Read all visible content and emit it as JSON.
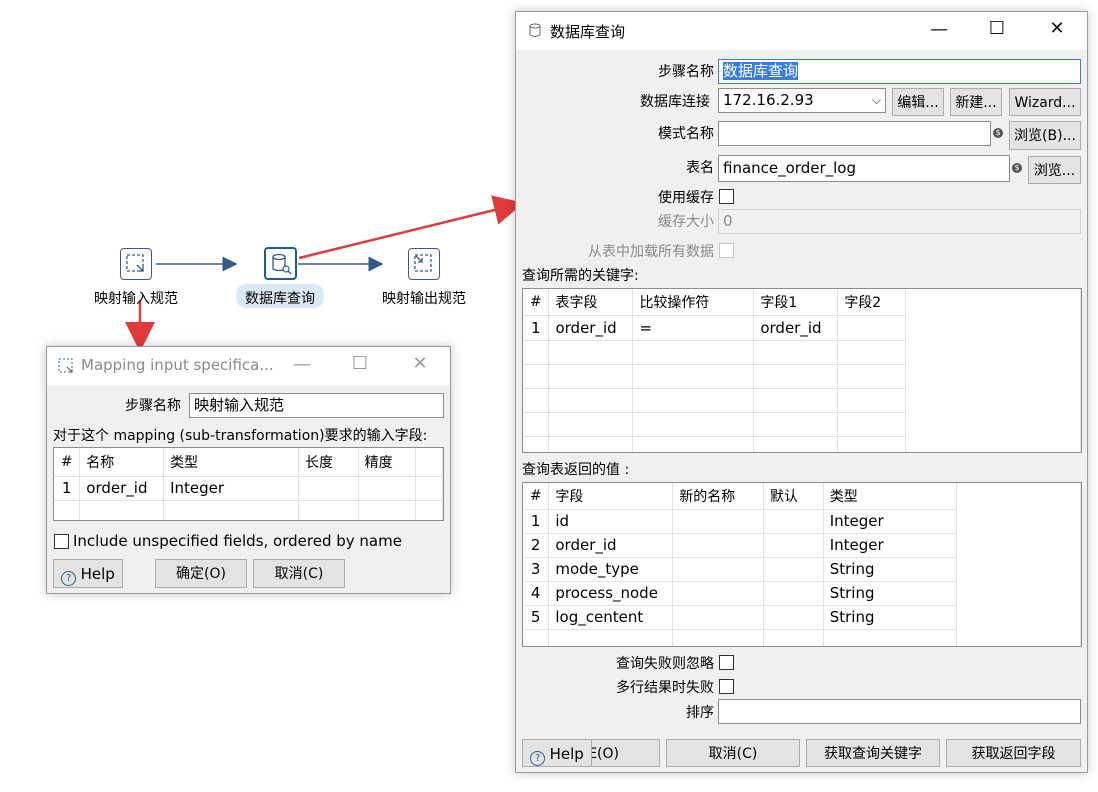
{
  "canvas": {
    "steps": [
      {
        "label": "映射输入规范"
      },
      {
        "label": "数据库查询"
      },
      {
        "label": "映射输出规范"
      }
    ]
  },
  "mapping_dialog": {
    "title": "Mapping input specifica...",
    "step_name_label": "步骤名称",
    "step_name_value": "映射输入规范",
    "fields_caption": "对于这个 mapping (sub-transformation)要求的输入字段:",
    "columns": [
      "#",
      "名称",
      "类型",
      "长度",
      "精度"
    ],
    "rows": [
      {
        "num": "1",
        "name": "order_id",
        "type": "Integer",
        "length": "",
        "precision": ""
      }
    ],
    "include_label": "Include unspecified fields, ordered by name",
    "help_label": "Help",
    "ok_label": "确定(O)",
    "cancel_label": "取消(C)"
  },
  "db_dialog": {
    "title": "数据库查询",
    "step_name_label": "步骤名称",
    "step_name_value": "数据库查询",
    "connection_label": "数据库连接",
    "connection_value": "172.16.2.93",
    "edit_label": "编辑...",
    "new_label": "新建...",
    "wizard_label": "Wizard...",
    "schema_label": "模式名称",
    "schema_value": "",
    "browse_b_label": "浏览(B)...",
    "table_label": "表名",
    "table_value": "finance_order_log",
    "browse_label": "浏览...",
    "cache_label": "使用缓存",
    "cache_size_label": "缓存大小",
    "cache_size_value": "0",
    "load_all_label": "从表中加载所有数据",
    "keys_caption": "查询所需的关键字:",
    "keys_columns": [
      "#",
      "表字段",
      "比较操作符",
      "字段1",
      "字段2"
    ],
    "keys_rows": [
      {
        "num": "1",
        "field": "order_id",
        "op": "=",
        "f1": "order_id",
        "f2": ""
      }
    ],
    "values_caption": "查询表返回的值 :",
    "values_columns": [
      "#",
      "字段",
      "新的名称",
      "默认",
      "类型"
    ],
    "values_rows": [
      {
        "num": "1",
        "field": "id",
        "newname": "",
        "default": "",
        "type": "Integer"
      },
      {
        "num": "2",
        "field": "order_id",
        "newname": "",
        "default": "",
        "type": "Integer"
      },
      {
        "num": "3",
        "field": "mode_type",
        "newname": "",
        "default": "",
        "type": "String"
      },
      {
        "num": "4",
        "field": "process_node",
        "newname": "",
        "default": "",
        "type": "String"
      },
      {
        "num": "5",
        "field": "log_centent",
        "newname": "",
        "default": "",
        "type": "String"
      }
    ],
    "fail_ignore_label": "查询失败则忽略",
    "multi_fail_label": "多行结果时失败",
    "order_label": "排序",
    "order_value": "",
    "help_label": "Help",
    "ok_label": "E(O)",
    "cancel_label": "取消(C)",
    "get_keys_label": "获取查询关键字",
    "get_fields_label": "获取返回字段"
  },
  "colors": {
    "arrow_red": "#e03a3a",
    "hop_blue": "#345c8a",
    "selection": "#3b7dd8"
  }
}
